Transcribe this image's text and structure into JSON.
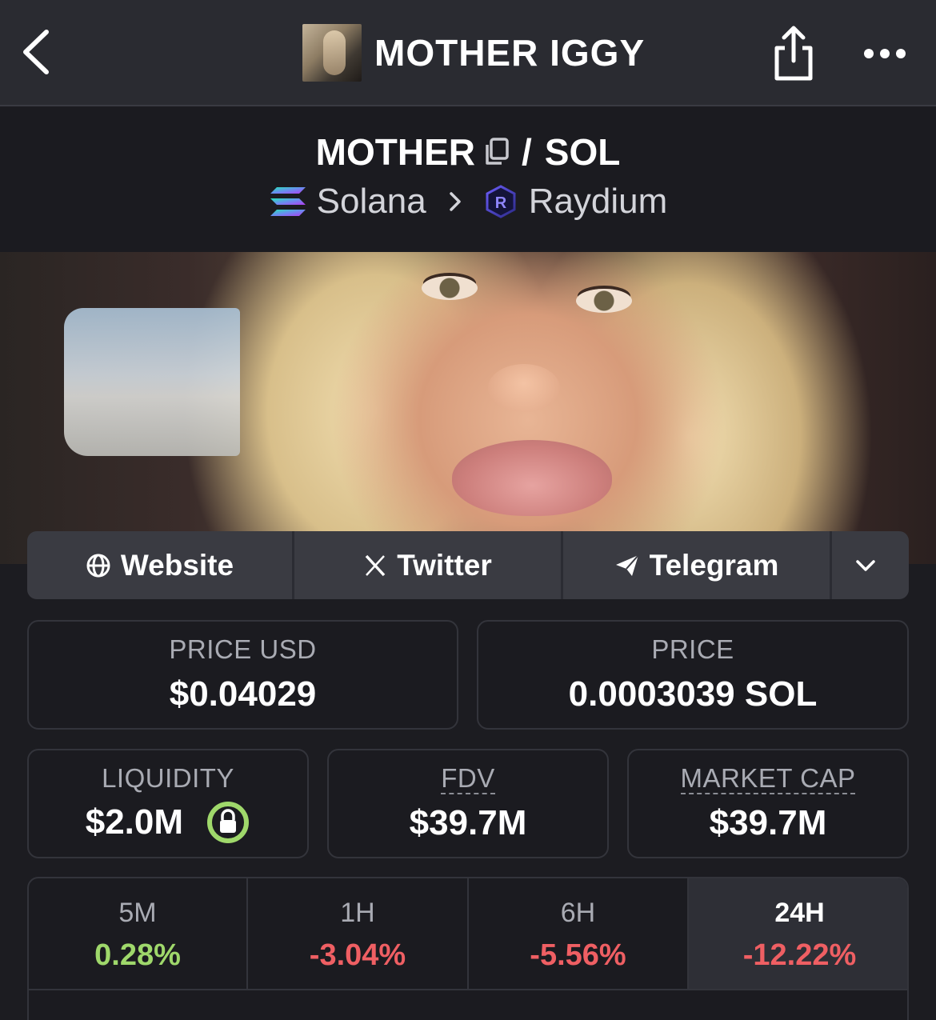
{
  "header": {
    "title": "MOTHER IGGY"
  },
  "pair": {
    "base": "MOTHER",
    "separator": "/",
    "quote": "SOL",
    "chain": "Solana",
    "dex": "Raydium"
  },
  "links": {
    "website": "Website",
    "twitter": "Twitter",
    "telegram": "Telegram"
  },
  "stats": {
    "price_usd_label": "PRICE USD",
    "price_usd": "$0.04029",
    "price_label": "PRICE",
    "price": "0.0003039 SOL",
    "liquidity_label": "LIQUIDITY",
    "liquidity": "$2.0M",
    "fdv_label": "FDV",
    "fdv": "$39.7M",
    "mcap_label": "MARKET CAP",
    "mcap": "$39.7M"
  },
  "changes": [
    {
      "label": "5M",
      "value": "0.28%",
      "color": "#9fd86b"
    },
    {
      "label": "1H",
      "value": "-3.04%",
      "color": "#ef5f63"
    },
    {
      "label": "6H",
      "value": "-5.56%",
      "color": "#ef5f63"
    },
    {
      "label": "24H",
      "value": "-12.22%",
      "color": "#ef5f63"
    }
  ],
  "colors": {
    "positive": "#9fd86b",
    "negative": "#ef5f63",
    "lock_ring": "#9fd86b"
  },
  "icons": [
    "back-arrow-icon",
    "share-icon",
    "more-icon",
    "copy-icon",
    "solana-icon",
    "chevron-right-icon",
    "raydium-icon",
    "globe-icon",
    "x-icon",
    "telegram-icon",
    "chevron-down-icon",
    "lock-icon"
  ]
}
